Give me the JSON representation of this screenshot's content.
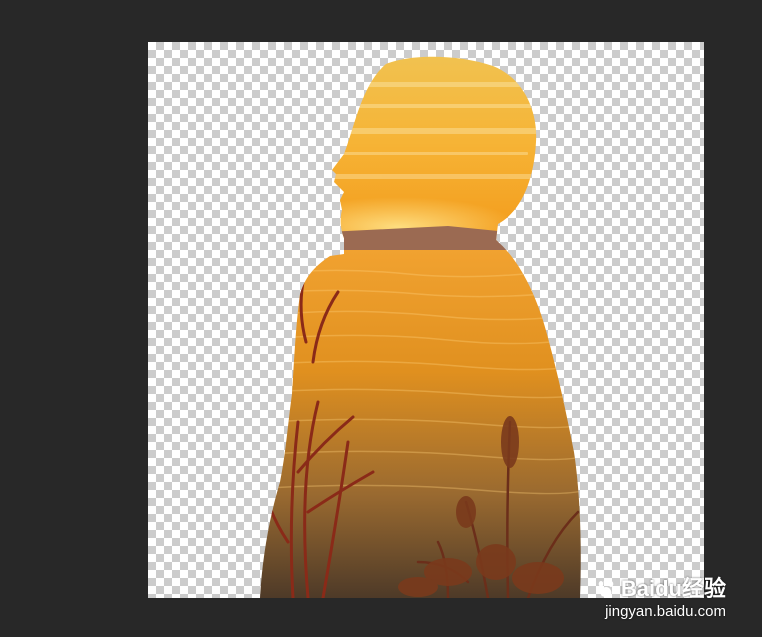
{
  "canvas": {
    "background": "transparency-checkerboard",
    "layer_content": "silhouette-of-person-filled-with-sunset-lake-photo"
  },
  "colors": {
    "workspace": "#282828",
    "sky_top": "#f3c24a",
    "sky_bottom": "#f29a1c",
    "water_top": "#e8921f",
    "water_bottom": "#6b4a2a",
    "reeds": "#7a2a1a"
  },
  "watermark": {
    "logo_text": "Baidu经验",
    "url": "jingyan.baidu.com"
  }
}
